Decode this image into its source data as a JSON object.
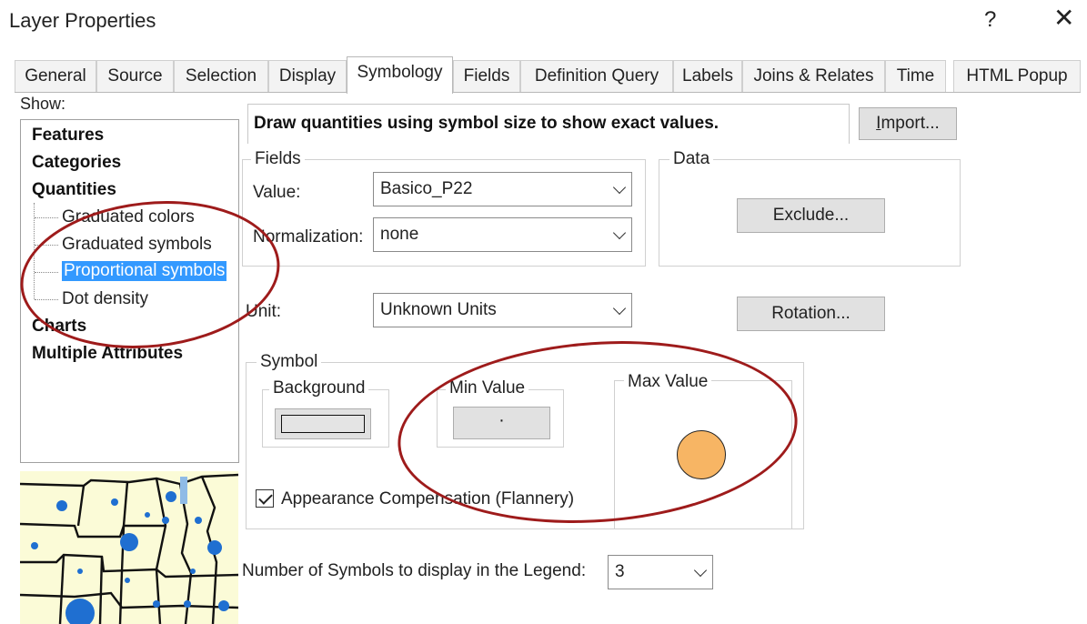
{
  "window": {
    "title": "Layer Properties",
    "help": "?",
    "close": "✕"
  },
  "tabs": [
    {
      "label": "General"
    },
    {
      "label": "Source"
    },
    {
      "label": "Selection"
    },
    {
      "label": "Display"
    },
    {
      "label": "Symbology"
    },
    {
      "label": "Fields"
    },
    {
      "label": "Definition Query"
    },
    {
      "label": "Labels"
    },
    {
      "label": "Joins & Relates"
    },
    {
      "label": "Time"
    },
    {
      "label": "HTML Popup"
    }
  ],
  "active_tab": "Symbology",
  "show": {
    "label": "Show:",
    "items": [
      {
        "label": "Features"
      },
      {
        "label": "Categories"
      },
      {
        "label": "Quantities"
      },
      {
        "label": "Graduated colors"
      },
      {
        "label": "Graduated symbols"
      },
      {
        "label": "Proportional symbols"
      },
      {
        "label": "Dot density"
      },
      {
        "label": "Charts"
      },
      {
        "label": "Multiple Attributes"
      }
    ],
    "selected": "Proportional symbols"
  },
  "description": "Draw quantities using symbol size to show exact values.",
  "import_button": "Import...",
  "fields": {
    "group_label": "Fields",
    "value_label": "Value:",
    "value": "Basico_P22",
    "normalization_label": "Normalization:",
    "normalization": "none"
  },
  "data_group": {
    "label": "Data",
    "exclude_button": "Exclude..."
  },
  "unit": {
    "label": "Unit:",
    "value": "Unknown Units"
  },
  "rotation_button": "Rotation...",
  "symbol": {
    "group_label": "Symbol",
    "background_label": "Background",
    "min_label": "Min Value",
    "max_label": "Max Value",
    "min_marker": "·",
    "max_symbol_color": "#f7b564",
    "compensation_label": "Appearance Compensation (Flannery)",
    "compensation_checked": true
  },
  "legend": {
    "label": "Number of Symbols to display in the Legend:",
    "value": "3"
  },
  "colors": {
    "annotation": "#9e1b1b",
    "selection": "#3399ff",
    "map_fill": "#fbfbd7",
    "map_dots": "#1f6fd1"
  }
}
